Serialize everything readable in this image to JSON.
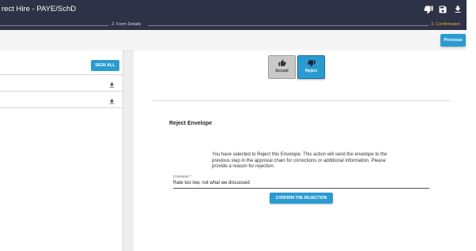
{
  "header": {
    "title": "rect Hire - PAYE/SchD",
    "icons": [
      "thumbs-down-icon",
      "save-icon",
      "download-icon"
    ]
  },
  "stepper": {
    "steps": [
      {
        "label": "2. Form Details",
        "state": "done"
      },
      {
        "label": "3. Confirmation",
        "state": "active"
      }
    ]
  },
  "toolbar": {
    "previous_label": "Previous"
  },
  "documents": {
    "sign_all_label": "SIGN ALL",
    "row_icons": [
      "download-icon",
      "download-icon"
    ]
  },
  "decision": {
    "accept_label": "Accept",
    "reject_label": "Reject",
    "selected": "Reject"
  },
  "reject_envelope": {
    "title": "Reject Envelope",
    "message": "You have selected to Reject this Envelope. This action will send the envelope to the previous step in the approval chain for corrections or additional information. Please provide a reason for rejection.",
    "comment_label": "Comment *",
    "comment_value": "Rate too low, not what we discussed",
    "confirm_label": "CONFIRM THE REJECTION"
  },
  "colors": {
    "header_bg": "#2e3246",
    "accent": "#2a9bd0",
    "active_step": "#f2a33a"
  }
}
